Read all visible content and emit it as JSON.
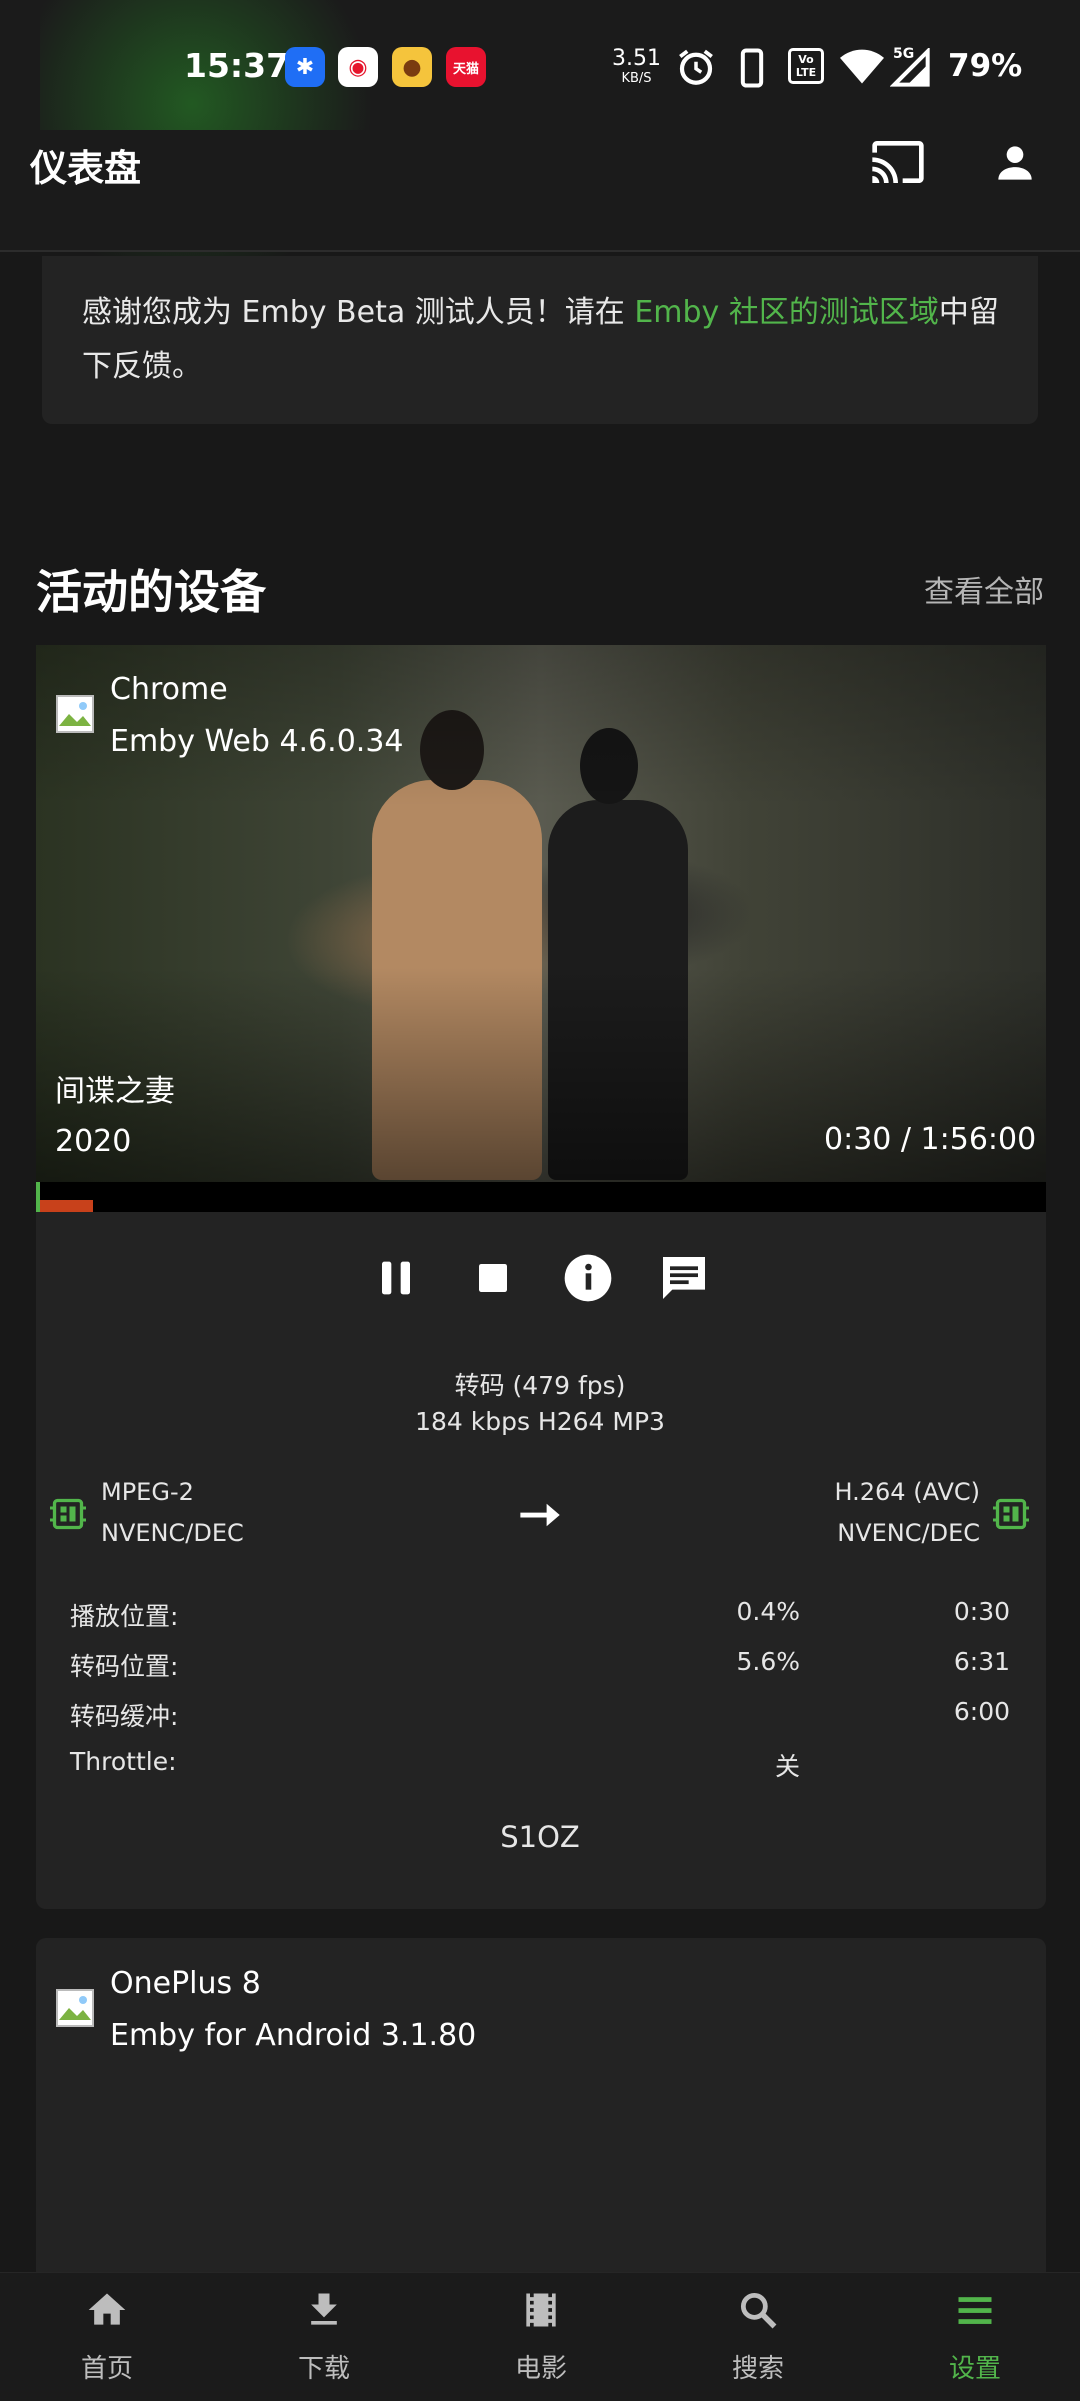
{
  "status_bar": {
    "time": "15:37",
    "net_speed_value": "3.51",
    "net_speed_unit": "KB/S",
    "battery": "79%",
    "network": "5G",
    "volte": "Vo LTE",
    "app_icons": [
      "bubble-star-icon",
      "weibo-icon",
      "pig-app-icon",
      "tmall-icon"
    ],
    "tmall_label": "天猫"
  },
  "app_bar": {
    "title": "仪表盘",
    "icons": [
      "cast-icon",
      "user-icon"
    ]
  },
  "notice": {
    "text_before": "感谢您成为 Emby Beta 测试人员！请在 ",
    "link": "Emby 社区的测试区域",
    "text_after": "中留下反馈。"
  },
  "active_devices": {
    "title": "活动的设备",
    "view_all": "查看全部"
  },
  "device1": {
    "client": "Chrome",
    "app": "Emby Web 4.6.0.34",
    "media_title": "间谍之妻",
    "media_year": "2020",
    "time": "0:30 / 1:56:00",
    "progress_fraction": 0.004,
    "transcode_fraction": 0.056,
    "controls": [
      "pause-icon",
      "stop-icon",
      "info-icon",
      "message-icon"
    ],
    "transcode_line1": "转码 (479 fps)",
    "transcode_line2": "184 kbps H264 MP3",
    "source_codec": "MPEG-2",
    "source_hw": "NVENC/DEC",
    "target_codec": "H.264 (AVC)",
    "target_hw": "NVENC/DEC",
    "stats": {
      "play_pos_label": "播放位置:",
      "play_pos_pct": "0.4%",
      "play_pos_time": "0:30",
      "trans_pos_label": "转码位置:",
      "trans_pos_pct": "5.6%",
      "trans_pos_time": "6:31",
      "buffer_label": "转码缓冲:",
      "buffer_time": "6:00",
      "throttle_label": "Throttle:",
      "throttle_value": "关"
    },
    "user": "S1OZ"
  },
  "device2": {
    "client": "OnePlus 8",
    "app": "Emby for Android 3.1.80"
  },
  "bottom_nav": {
    "items": [
      {
        "label": "首页",
        "icon": "home-icon"
      },
      {
        "label": "下载",
        "icon": "download-icon"
      },
      {
        "label": "电影",
        "icon": "movie-icon"
      },
      {
        "label": "搜索",
        "icon": "search-icon"
      },
      {
        "label": "设置",
        "icon": "menu-icon"
      }
    ],
    "active": "设置"
  },
  "colors": {
    "accent": "#52b54b",
    "progress": "#c8411b",
    "background": "#181818",
    "card": "#232323"
  }
}
